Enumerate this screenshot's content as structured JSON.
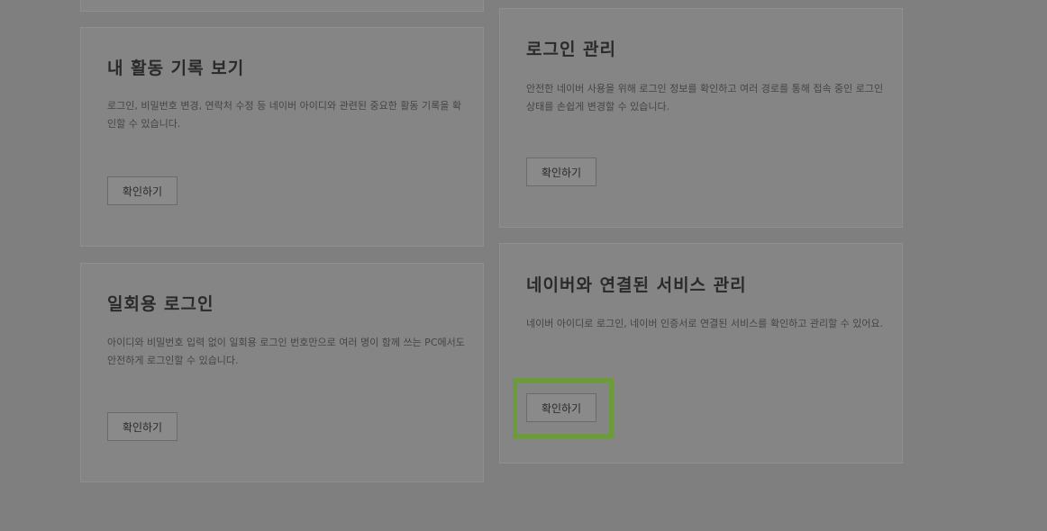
{
  "cards": {
    "activity": {
      "title": "내 활동 기록 보기",
      "desc": "로그인, 비밀번호 변경, 연락처 수정 등 네이버 아이디와 관련된 중요한 활동 기록을 확인할 수 있습니다.",
      "button": "확인하기"
    },
    "login_manage": {
      "title": "로그인 관리",
      "desc": "안전한 네이버 사용을 위해 로그인 정보를 확인하고 여러 경로를 통해 접속 중인 로그인 상태를 손쉽게 변경할 수 있습니다.",
      "button": "확인하기"
    },
    "onetime_login": {
      "title": "일회용 로그인",
      "desc": "아이디와 비밀번호 입력 없이 일회용 로그인 번호만으로 여러 명이 함께 쓰는 PC에서도 안전하게 로그인할 수 있습니다.",
      "button": "확인하기"
    },
    "connected_services": {
      "title": "네이버와 연결된 서비스 관리",
      "desc": "네이버 아이디로 로그인, 네이버 인증서로 연결된 서비스를 확인하고 관리할 수 있어요.",
      "button": "확인하기"
    }
  },
  "colors": {
    "overlay_background": "#7f7f7f",
    "highlight_border": "#6d9a3a"
  }
}
